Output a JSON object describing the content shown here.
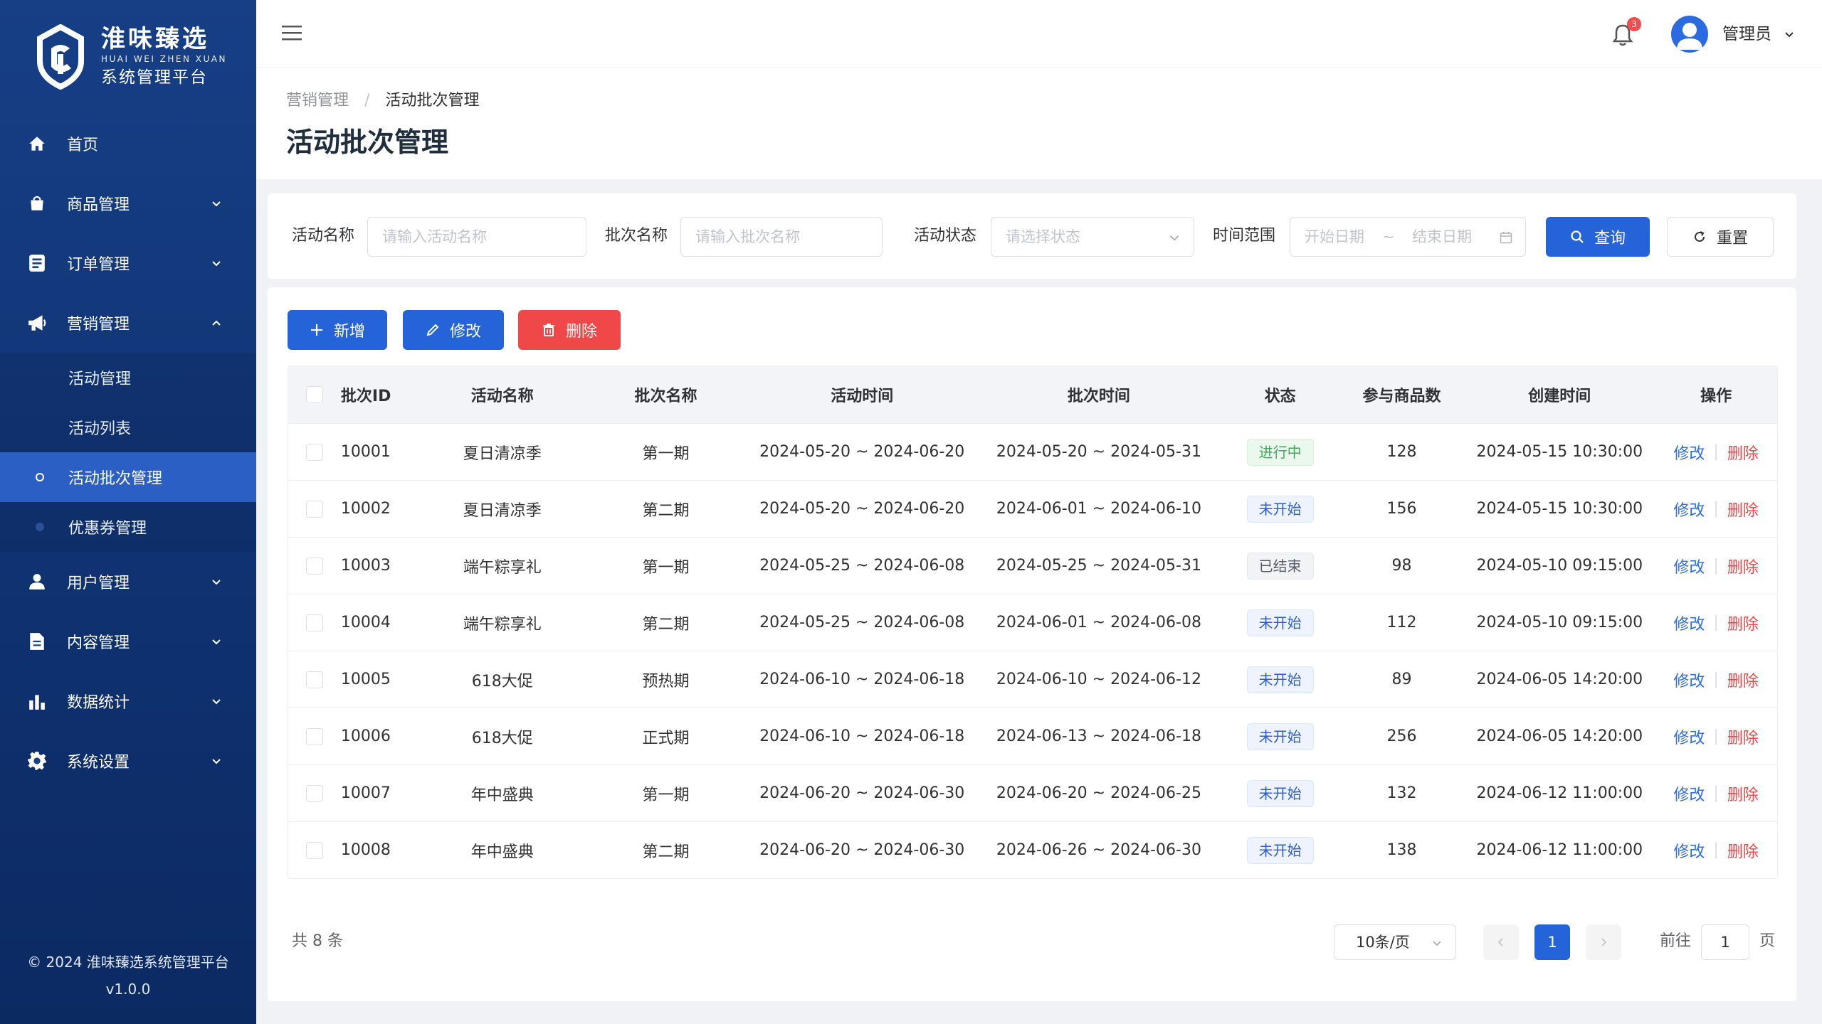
{
  "brand": {
    "name_cn": "淮味臻选",
    "name_en": "HUAI WEI ZHEN XUAN",
    "subtitle": "系统管理平台"
  },
  "sidebar": {
    "items": [
      {
        "label": "首页",
        "icon": "home-icon"
      },
      {
        "label": "商品管理",
        "icon": "bag-icon"
      },
      {
        "label": "订单管理",
        "icon": "order-icon"
      },
      {
        "label": "营销管理",
        "icon": "megaphone-icon",
        "expanded": true
      },
      {
        "label": "用户管理",
        "icon": "user-icon"
      },
      {
        "label": "内容管理",
        "icon": "document-icon"
      },
      {
        "label": "数据统计",
        "icon": "bar-chart-icon"
      },
      {
        "label": "系统设置",
        "icon": "gear-icon"
      }
    ],
    "marketing_sub": [
      {
        "label": "活动管理"
      },
      {
        "label": "活动列表"
      },
      {
        "label": "活动批次管理",
        "active": true
      },
      {
        "label": "优惠券管理"
      }
    ],
    "footer": {
      "copyright": "© 2024 淮味臻选系统管理平台",
      "version": "v1.0.0"
    }
  },
  "header": {
    "notification_count": "3",
    "user_name": "管理员"
  },
  "breadcrumb": {
    "parent": "营销管理",
    "separator": "/",
    "current": "活动批次管理"
  },
  "page_title": "活动批次管理",
  "search": {
    "activity_name_label": "活动名称",
    "activity_name_placeholder": "请输入活动名称",
    "batch_name_label": "批次名称",
    "batch_name_placeholder": "请输入批次名称",
    "status_label": "活动状态",
    "status_placeholder": "请选择状态",
    "time_range_label": "时间范围",
    "start_placeholder": "开始日期",
    "range_sep": "~",
    "end_placeholder": "结束日期",
    "query_label": "查询",
    "reset_label": "重置"
  },
  "toolbar": {
    "add_label": "新增",
    "edit_label": "修改",
    "delete_label": "删除"
  },
  "table": {
    "columns": [
      "批次ID",
      "活动名称",
      "批次名称",
      "活动时间",
      "批次时间",
      "状态",
      "参与商品数",
      "创建时间",
      "操作"
    ],
    "rows": [
      {
        "id": "10001",
        "activity": "夏日清凉季",
        "batch": "第一期",
        "activity_time": "2024-05-20 ~ 2024-06-20",
        "batch_time": "2024-05-20 ~ 2024-05-31",
        "status": "进行中",
        "status_type": "green",
        "count": "128",
        "created": "2024-05-15 10:30:00"
      },
      {
        "id": "10002",
        "activity": "夏日清凉季",
        "batch": "第二期",
        "activity_time": "2024-05-20 ~ 2024-06-20",
        "batch_time": "2024-06-01 ~ 2024-06-10",
        "status": "未开始",
        "status_type": "blue",
        "count": "156",
        "created": "2024-05-15 10:30:00"
      },
      {
        "id": "10003",
        "activity": "端午粽享礼",
        "batch": "第一期",
        "activity_time": "2024-05-25 ~ 2024-06-08",
        "batch_time": "2024-05-25 ~ 2024-05-31",
        "status": "已结束",
        "status_type": "gray",
        "count": "98",
        "created": "2024-05-10 09:15:00"
      },
      {
        "id": "10004",
        "activity": "端午粽享礼",
        "batch": "第二期",
        "activity_time": "2024-05-25 ~ 2024-06-08",
        "batch_time": "2024-06-01 ~ 2024-06-08",
        "status": "未开始",
        "status_type": "blue",
        "count": "112",
        "created": "2024-05-10 09:15:00"
      },
      {
        "id": "10005",
        "activity": "618大促",
        "batch": "预热期",
        "activity_time": "2024-06-10 ~ 2024-06-18",
        "batch_time": "2024-06-10 ~ 2024-06-12",
        "status": "未开始",
        "status_type": "blue",
        "count": "89",
        "created": "2024-06-05 14:20:00"
      },
      {
        "id": "10006",
        "activity": "618大促",
        "batch": "正式期",
        "activity_time": "2024-06-10 ~ 2024-06-18",
        "batch_time": "2024-06-13 ~ 2024-06-18",
        "status": "未开始",
        "status_type": "blue",
        "count": "256",
        "created": "2024-06-05 14:20:00"
      },
      {
        "id": "10007",
        "activity": "年中盛典",
        "batch": "第一期",
        "activity_time": "2024-06-20 ~ 2024-06-30",
        "batch_time": "2024-06-20 ~ 2024-06-25",
        "status": "未开始",
        "status_type": "blue",
        "count": "132",
        "created": "2024-06-12 11:00:00"
      },
      {
        "id": "10008",
        "activity": "年中盛典",
        "batch": "第二期",
        "activity_time": "2024-06-20 ~ 2024-06-30",
        "batch_time": "2024-06-26 ~ 2024-06-30",
        "status": "未开始",
        "status_type": "blue",
        "count": "138",
        "created": "2024-06-12 11:00:00"
      }
    ],
    "op_edit": "修改",
    "op_sep": "|",
    "op_delete": "删除"
  },
  "pagination": {
    "total_text": "共 8 条",
    "page_size": "10条/页",
    "current_page": "1",
    "goto_prefix": "前往",
    "goto_value": "1",
    "goto_suffix": "页"
  },
  "colors": {
    "primary": "#2563d9",
    "danger": "#f04848",
    "sidebar": "#173f86",
    "success": "#3eab5b"
  }
}
